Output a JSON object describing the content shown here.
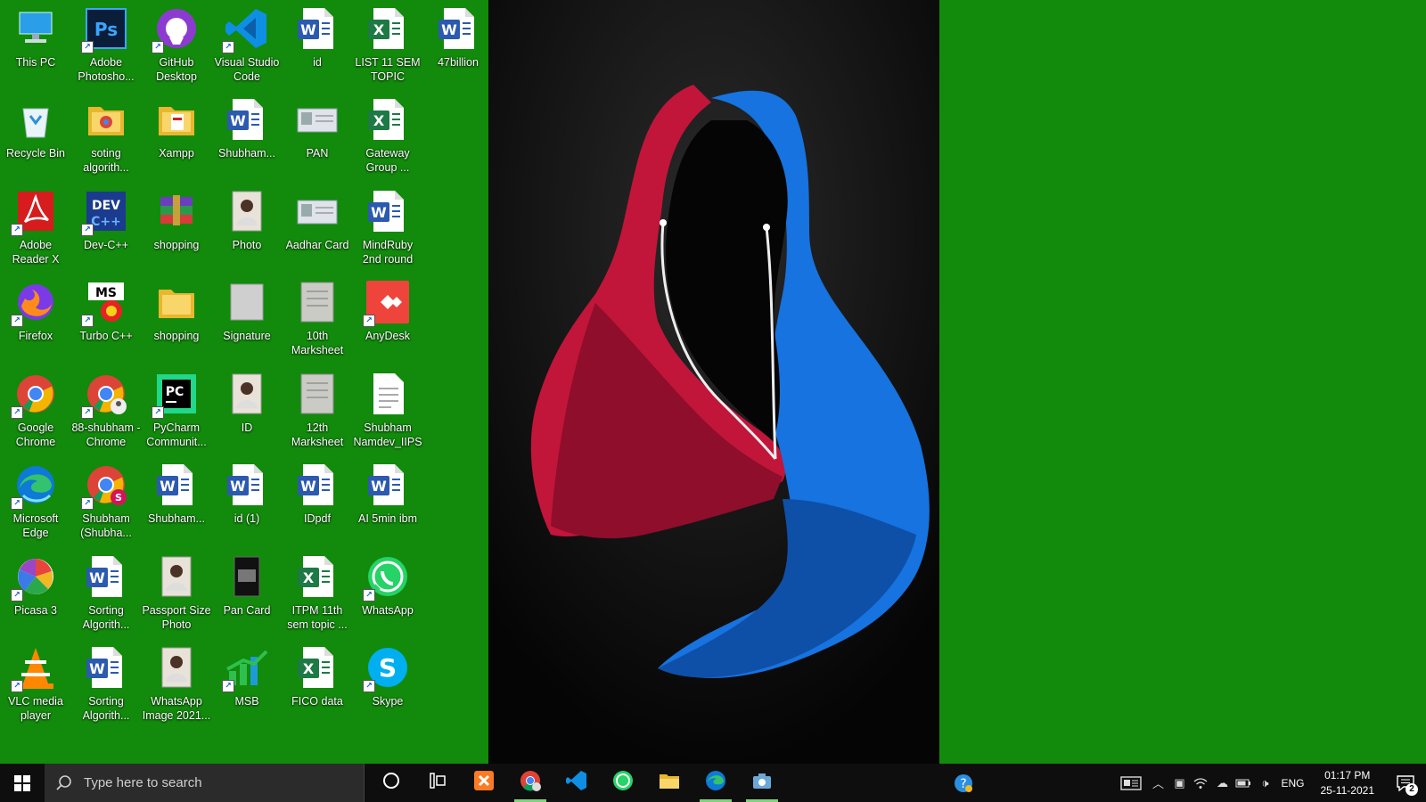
{
  "desktop": {
    "columns": [
      [
        "This PC",
        "Recycle Bin",
        "Adobe Reader X",
        "Firefox",
        "Google Chrome",
        "Microsoft Edge",
        "Picasa 3",
        "VLC media player"
      ],
      [
        "Adobe Photosho...",
        "soting algorith...",
        "Dev-C++",
        "Turbo C++",
        "88-shubham - Chrome",
        "Shubham (Shubha...",
        "Sorting Algorith...",
        "Sorting Algorith..."
      ],
      [
        "GitHub Desktop",
        "Xampp",
        "shopping",
        "shopping",
        "PyCharm Communit...",
        "Shubham...",
        "Passport Size Photo",
        "WhatsApp Image 2021..."
      ],
      [
        "Visual Studio Code",
        "Shubham...",
        "Photo",
        "Signature",
        "ID",
        "id (1)",
        "Pan Card",
        "MSB"
      ],
      [
        "id",
        "PAN",
        "Aadhar Card",
        "10th Marksheet",
        "12th Marksheet",
        "IDpdf",
        "ITPM 11th sem topic ...",
        "FICO data"
      ],
      [
        "LIST 11 SEM TOPIC",
        "Gateway Group ...",
        "MindRuby 2nd round",
        "AnyDesk",
        "Shubham Namdev_IIPS",
        "AI 5min ibm",
        "WhatsApp",
        "Skype"
      ],
      [
        "47billion"
      ]
    ],
    "icon_types": [
      [
        "this-pc",
        "recycle-bin",
        "adobe-reader",
        "firefox",
        "chrome",
        "edge",
        "picasa",
        "vlc"
      ],
      [
        "photoshop",
        "folder-chrome",
        "devcpp",
        "turbocpp",
        "chrome-user",
        "chrome-user-s",
        "word",
        "word"
      ],
      [
        "github",
        "folder-doc",
        "winrar",
        "folder",
        "pycharm",
        "word",
        "photo-portrait",
        "photo-portrait"
      ],
      [
        "vscode",
        "word",
        "photo-portrait",
        "image-blank",
        "photo-portrait",
        "word",
        "photo-card-dark",
        "msb"
      ],
      [
        "word",
        "image-card",
        "image-card",
        "image-doc",
        "image-doc",
        "word",
        "excel",
        "excel"
      ],
      [
        "excel",
        "excel",
        "word",
        "anydesk",
        "text-doc",
        "word",
        "whatsapp",
        "skype"
      ],
      [
        "word"
      ]
    ]
  },
  "taskbar": {
    "search_placeholder": "Type here to search",
    "pinned": [
      {
        "name": "cortana-button",
        "icon": "cortana-icon"
      },
      {
        "name": "task-view-button",
        "icon": "task-view-icon"
      },
      {
        "name": "xampp-taskbar-button",
        "icon": "xampp-icon"
      },
      {
        "name": "chrome-taskbar-button",
        "icon": "chrome-icon",
        "active": true
      },
      {
        "name": "vscode-taskbar-button",
        "icon": "vscode-icon"
      },
      {
        "name": "whatsapp-taskbar-button",
        "icon": "whatsapp-icon"
      },
      {
        "name": "file-explorer-taskbar-button",
        "icon": "folder-icon"
      },
      {
        "name": "edge-taskbar-button",
        "icon": "edge-icon",
        "active": true
      },
      {
        "name": "camera-taskbar-button",
        "icon": "camera-icon",
        "active": true
      }
    ],
    "tray": {
      "language": "ENG",
      "time": "01:17 PM",
      "date": "25-11-2021",
      "notification_count": "2"
    }
  },
  "colors": {
    "desktop_bg": "#128a0c",
    "taskbar_bg": "#0e0e0e",
    "hood_red": "#d0183f",
    "hood_blue": "#1673e0"
  }
}
